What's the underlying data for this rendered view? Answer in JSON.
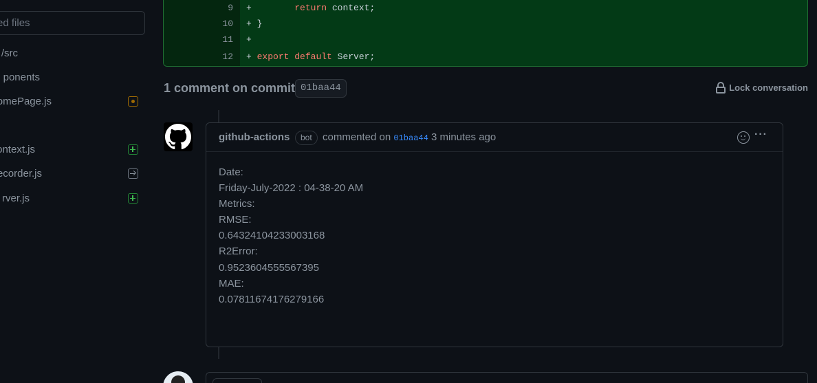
{
  "sidebar": {
    "filter_placeholder": "anged files",
    "items": [
      {
        "label": "/src",
        "status": ""
      },
      {
        "label": "ponents",
        "status": ""
      },
      {
        "label": "omePage.js",
        "status": "modified"
      },
      {
        "label": "ontext.js",
        "status": "added"
      },
      {
        "label": "ecorder.js",
        "status": "renamed"
      },
      {
        "label": "rver.js",
        "status": "added"
      }
    ]
  },
  "diff": {
    "rows": [
      {
        "line": "9",
        "prefix": "+",
        "indent": "        ",
        "keyword": "return",
        "rest": " context;"
      },
      {
        "line": "10",
        "prefix": "+",
        "indent": " ",
        "keyword": "",
        "rest": "}"
      },
      {
        "line": "11",
        "prefix": "+",
        "indent": "",
        "keyword": "",
        "rest": ""
      },
      {
        "line": "12",
        "prefix": "+",
        "indent": " ",
        "keyword": "export default",
        "rest": " Server;"
      }
    ]
  },
  "comments_section": {
    "title": "1 comment on commit",
    "commit_sha": "01baa44",
    "lock_label": "Lock conversation"
  },
  "comment": {
    "author": "github-actions",
    "badge": "bot",
    "action": "commented on",
    "sha": "01baa44",
    "time": "3 minutes ago",
    "body": [
      "Date:",
      "Friday-July-2022 : 04-38-20 AM",
      "Metrics:",
      "RMSE:",
      "0.64324104233003168",
      "R2Error:",
      "0.9523604555567395",
      "MAE:",
      "0.07811674176279166"
    ]
  },
  "colors": {
    "background": "#0d1117",
    "diff_added_bg": "#033a16",
    "link": "#388bfd",
    "keyword": "#ff7b72"
  },
  "icons": [
    "file-modified-icon",
    "file-added-icon",
    "file-renamed-icon",
    "lock-icon",
    "github-mark-icon",
    "smiley-icon",
    "kebab-menu-icon"
  ]
}
